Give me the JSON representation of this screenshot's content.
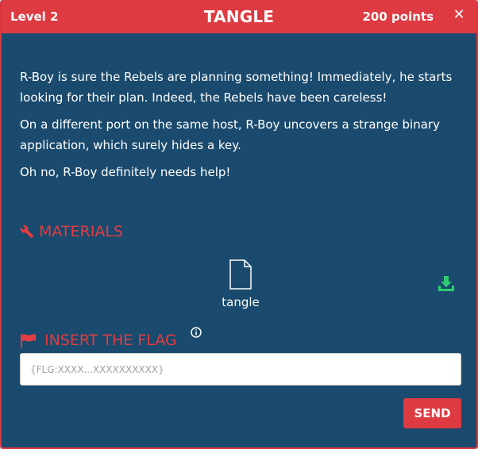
{
  "header": {
    "level": "Level 2",
    "title": "TANGLE",
    "points": "200 points",
    "close_icon": "close-icon"
  },
  "description": [
    "R-Boy is sure the Rebels are planning something! Immediately, he starts looking for their plan. Indeed, the Rebels have been careless!",
    "On a different port on the same host, R-Boy uncovers a strange binary application, which surely hides a key.",
    "Oh no, R-Boy definitely needs help!"
  ],
  "materials": {
    "heading": "MATERIALS",
    "icon": "wrench-icon",
    "files": [
      {
        "name": "tangle",
        "icon": "file-icon",
        "download_icon": "download-icon"
      }
    ]
  },
  "flag": {
    "heading": "INSERT THE FLAG",
    "icon": "flag-icon",
    "info_icon": "info-icon",
    "input_value": "",
    "placeholder": "{FLG:XXXX...XXXXXXXXXX}",
    "send_label": "SEND"
  },
  "colors": {
    "accent": "#dd3a41",
    "panel": "#1a4a6d",
    "download": "#2ecc71"
  }
}
